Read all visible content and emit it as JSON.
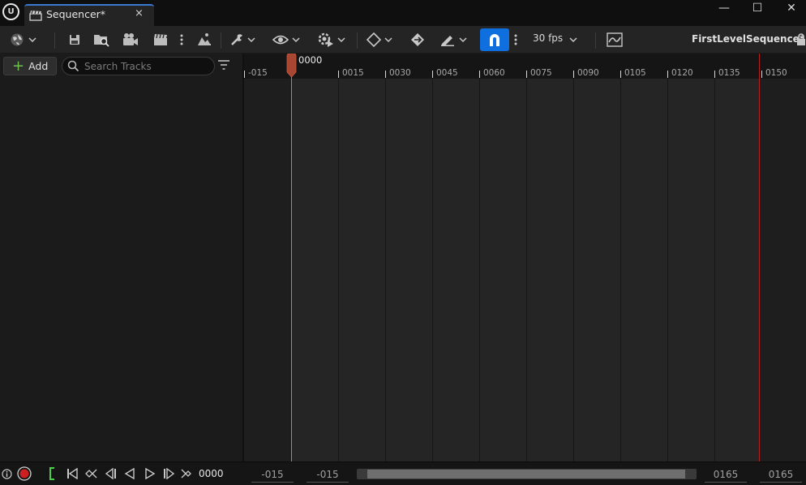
{
  "titlebar": {
    "tab_label": "Sequencer*",
    "tab_close": "×",
    "logo_text": "U",
    "minimize": "—",
    "maximize": "☐",
    "close": "✕"
  },
  "toolbar": {
    "fps_label": "30 fps",
    "sequence_name": "FirstLevelSequence*",
    "snap_active_color": "#0f6fdf"
  },
  "tracks": {
    "add_label": "Add",
    "search_placeholder": "Search Tracks"
  },
  "timeline": {
    "playhead_frame": "0000",
    "ruler_labels": [
      "-015",
      "0015",
      "0030",
      "0045",
      "0060",
      "0075",
      "0090",
      "0105",
      "0120",
      "0135",
      "0150"
    ]
  },
  "bottombar": {
    "current_frame": "0000",
    "view_start": "-015",
    "working_start": "-015",
    "working_end": "0165",
    "view_end": "0165"
  },
  "colors": {
    "start_marker": "#48c048",
    "end_marker": "#b22020",
    "playhead": "#a84632"
  }
}
